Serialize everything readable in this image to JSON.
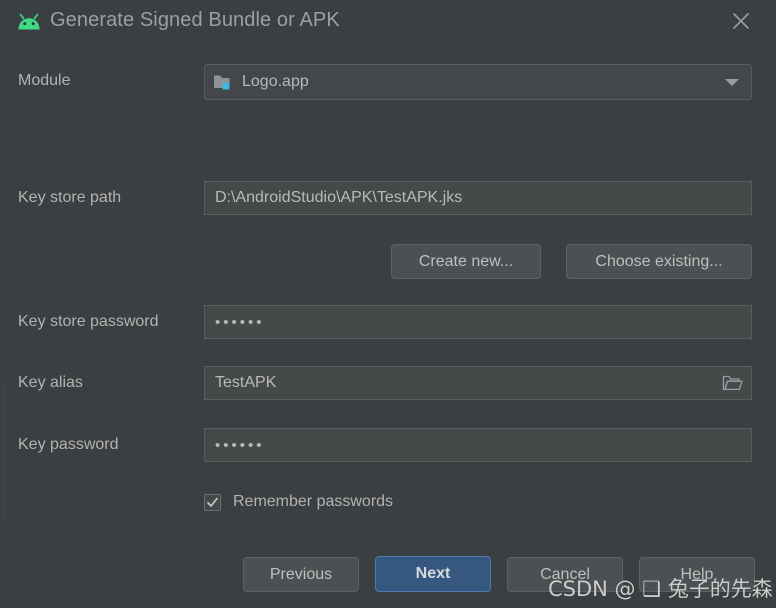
{
  "window": {
    "title": "Generate Signed Bundle or APK",
    "icon": "android-robot-icon",
    "close_icon": "close-icon",
    "background_color": "#3c3f41",
    "accent_color": "#365880",
    "android_green": "#3ddc84"
  },
  "form": {
    "module": {
      "label": "Module",
      "value": "Logo.app",
      "icon": "android-module-folder-icon",
      "dropdown_icon": "chevron-down-icon"
    },
    "key_store_path": {
      "label": "Key store path",
      "value": "D:\\AndroidStudio\\APK\\TestAPK.jks"
    },
    "key_store_password": {
      "label": "Key store password",
      "value": "••••••",
      "masked_length": 6
    },
    "key_alias": {
      "label": "Key alias",
      "value": "TestAPK",
      "browse_icon": "folder-open-icon"
    },
    "key_password": {
      "label": "Key password",
      "value": "••••••",
      "masked_length": 6
    },
    "remember_passwords": {
      "label": "Remember passwords",
      "checked": true,
      "check_icon": "checkmark-icon"
    }
  },
  "keystore_actions": {
    "create_new": "Create new...",
    "choose_existing": "Choose existing..."
  },
  "footer": {
    "previous": "Previous",
    "next": "Next",
    "cancel": "Cancel",
    "help": "Help",
    "default_button": "Next"
  },
  "watermark": {
    "text": "CSDN @ ❑ 兔子的先森 ❑"
  }
}
